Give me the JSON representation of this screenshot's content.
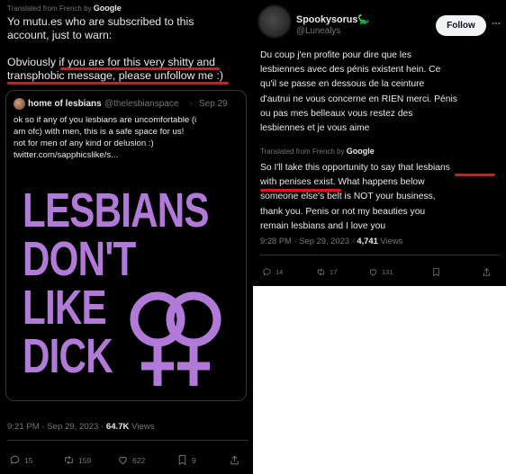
{
  "left_tweet": {
    "translated_label": "Translated from French by",
    "translated_brand": "Google",
    "text_line1": "Yo mutu.es who are subscribed to this",
    "text_line2": "account, just to warn:",
    "text_line3_a": "Obviously ",
    "text_line3_b": "if you are for this very shitty and",
    "text_line4": "transphobic message, please unfollow me :)",
    "quote": {
      "name": "home of lesbians",
      "handle": "@thelesbianspace",
      "dot": "·",
      "date": "Sep 29",
      "text_line1": "ok so if any of you lesbians are uncomfortable (i",
      "text_line2": "am ofc) with men, this is a safe space for us!",
      "text_line3": "not for men of any kind or delusion :)",
      "text_line4": "twitter.com/sapphicslike/s...",
      "image_words": [
        "LESBIANS",
        "DON'T",
        "LIKE",
        "DICK"
      ]
    },
    "time": "9:21 PM · Sep 29, 2023 · ",
    "views_count": "64.7K",
    "views_label": " Views",
    "actions": {
      "reply_count": "15",
      "retweet_count": "159",
      "like_count": "622",
      "bookmark_count": "9"
    },
    "underline_color": "#e0141e"
  },
  "right_tweet": {
    "name": "Spookysorus",
    "name_emoji": "🦕",
    "handle": "@Lunealys",
    "follow_label": "Follow",
    "french_line1": "Du coup j'en profite pour dire que les",
    "french_line2": "lesbiennes avec des pénis existent hein. Ce",
    "french_line3": "qu'il se passe en dessous de la ceinture",
    "french_line4": "d'autrui ne vous concerne en RIEN merci. Pénis",
    "french_line5": "ou pas mes belleaux vous restez des",
    "french_line6": "lesbiennes et je vous aime",
    "translated_label": "Translated from French by",
    "translated_brand": "Google",
    "english_line1_a": "So I'll take this opportunity to say that ",
    "english_line1_b": "lesbians",
    "english_line2_a": "with penises exist.",
    "english_line2_b": " What happens below",
    "english_line3": "someone else's belt is NOT your business,",
    "english_line4": "thank you. Penis or not my beauties you",
    "english_line5": "remain lesbians and I love you",
    "time": "9:28 PM · Sep 29, 2023 · ",
    "views_count": "4,741",
    "views_label": " Views",
    "actions": {
      "reply_count": "14",
      "retweet_count": "17",
      "like_count": "131"
    }
  },
  "colors": {
    "background": "#000000",
    "text": "#e7e9ea",
    "muted": "#71767b",
    "image_text": "#b27ad8",
    "underline": "#e0141e"
  }
}
